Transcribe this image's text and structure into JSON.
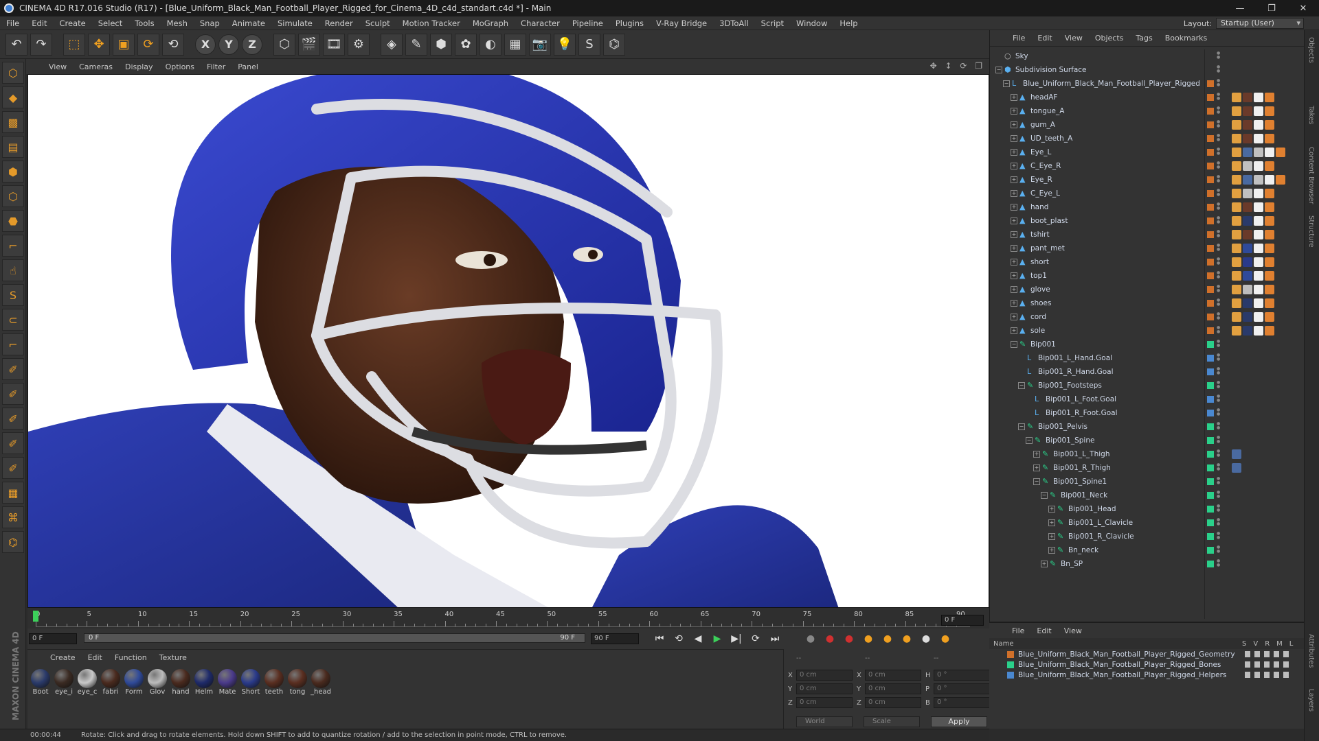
{
  "window": {
    "title": "CINEMA 4D R17.016 Studio (R17) - [Blue_Uniform_Black_Man_Football_Player_Rigged_for_Cinema_4D_c4d_standart.c4d *] - Main",
    "controls": [
      "—",
      "❐",
      "✕"
    ]
  },
  "menubar": {
    "items": [
      "File",
      "Edit",
      "Create",
      "Select",
      "Tools",
      "Mesh",
      "Snap",
      "Animate",
      "Simulate",
      "Render",
      "Sculpt",
      "Motion Tracker",
      "MoGraph",
      "Character",
      "Pipeline",
      "Plugins",
      "V-Ray Bridge",
      "3DToAll",
      "Script",
      "Window",
      "Help"
    ],
    "layout_label": "Layout:",
    "layout_value": "Startup (User)"
  },
  "toolbar": {
    "buttons": [
      {
        "name": "undo-icon",
        "glyph": "↶"
      },
      {
        "name": "redo-icon",
        "glyph": "↷"
      },
      {
        "name": "live-selection-icon",
        "glyph": "⬚"
      },
      {
        "name": "move-icon",
        "glyph": "✥"
      },
      {
        "name": "scale-icon",
        "glyph": "▣"
      },
      {
        "name": "rotate-icon",
        "glyph": "⟳"
      },
      {
        "name": "recent-tool-icon",
        "glyph": "⟲"
      }
    ],
    "axes": [
      "X",
      "Y",
      "Z"
    ],
    "buttons2": [
      {
        "name": "coordinate-system-icon",
        "glyph": "⬡"
      },
      {
        "name": "render-view-icon",
        "glyph": "🎬"
      },
      {
        "name": "render-picture-viewer-icon",
        "glyph": "🎞"
      },
      {
        "name": "render-settings-icon",
        "glyph": "⚙"
      },
      {
        "name": "cube-icon",
        "glyph": "◈"
      },
      {
        "name": "pen-icon",
        "glyph": "✎"
      },
      {
        "name": "subdivision-icon",
        "glyph": "⬢"
      },
      {
        "name": "cloner-icon",
        "glyph": "✿"
      },
      {
        "name": "deformer-icon",
        "glyph": "◐"
      },
      {
        "name": "floor-icon",
        "glyph": "▦"
      },
      {
        "name": "camera-icon",
        "glyph": "📷"
      },
      {
        "name": "light-icon",
        "glyph": "💡"
      },
      {
        "name": "vray-icon",
        "glyph": "S"
      },
      {
        "name": "python-icon",
        "glyph": "⌬"
      }
    ]
  },
  "left_tools": [
    {
      "name": "make-editable-icon",
      "glyph": "⬡"
    },
    {
      "name": "model-mode-icon",
      "glyph": "◆"
    },
    {
      "name": "texture-mode-icon",
      "glyph": "▩"
    },
    {
      "name": "workplane-icon",
      "glyph": "▤"
    },
    {
      "name": "points-mode-icon",
      "glyph": "⬢"
    },
    {
      "name": "edges-mode-icon",
      "glyph": "⬡"
    },
    {
      "name": "polygons-mode-icon",
      "glyph": "⬣"
    },
    {
      "name": "axis-mode-icon",
      "glyph": "⌐"
    },
    {
      "name": "tweak-mode-icon",
      "glyph": "☝"
    },
    {
      "name": "snap-icon",
      "glyph": "S"
    },
    {
      "name": "magnet-icon",
      "glyph": "⊂"
    },
    {
      "name": "workplane-axis-icon",
      "glyph": "⌐"
    },
    {
      "name": "brush-icon",
      "glyph": "✐"
    },
    {
      "name": "sculpt-icon",
      "glyph": "✐"
    },
    {
      "name": "paint-icon",
      "glyph": "✐"
    },
    {
      "name": "smooth-icon",
      "glyph": "✐"
    },
    {
      "name": "knife-icon",
      "glyph": "✐"
    },
    {
      "name": "lock-workplane-icon",
      "glyph": "▦"
    },
    {
      "name": "bridge-icon",
      "glyph": "⌘"
    },
    {
      "name": "python-icon",
      "glyph": "⌬"
    }
  ],
  "branding": "MAXON CINEMA 4D",
  "viewport": {
    "menu": [
      "View",
      "Cameras",
      "Display",
      "Options",
      "Filter",
      "Panel"
    ],
    "nav_icons": "✥ ↕ ⟳ ❐"
  },
  "timeline": {
    "ticks": [
      "0",
      "5",
      "10",
      "15",
      "20",
      "25",
      "30",
      "35",
      "40",
      "45",
      "50",
      "55",
      "60",
      "65",
      "70",
      "75",
      "80",
      "85",
      "90"
    ],
    "current_frame": "0 F"
  },
  "transport": {
    "start_frame": "0 F",
    "range_start": "0 F",
    "range_end": "90 F",
    "end_frame": "90 F",
    "buttons": [
      "⏮",
      "⟲",
      "◀",
      "▶",
      "▶|",
      "⟳",
      "⏭"
    ]
  },
  "material_panel": {
    "menu": [
      "Create",
      "Edit",
      "Function",
      "Texture"
    ],
    "materials": [
      {
        "label": "Boot",
        "color": "#2a3a6a"
      },
      {
        "label": "eye_i",
        "color": "#3a2a22"
      },
      {
        "label": "eye_c",
        "color": "#c9c9c9"
      },
      {
        "label": "fabri",
        "color": "#4a2a1e"
      },
      {
        "label": "Form",
        "color": "#2f4a9a"
      },
      {
        "label": "Glov",
        "color": "#bdbdbd"
      },
      {
        "label": "hand",
        "color": "#4a2a1e"
      },
      {
        "label": "Helm",
        "color": "#1e2a6a"
      },
      {
        "label": "Mate",
        "color": "#4a3a8a"
      },
      {
        "label": "Short",
        "color": "#2a3a8a"
      },
      {
        "label": "teeth",
        "color": "#5a2e20"
      },
      {
        "label": "tong",
        "color": "#5a2e20"
      },
      {
        "label": "_head",
        "color": "#4a2a1e"
      }
    ]
  },
  "coordinates": {
    "header": [
      "--",
      "--",
      "--"
    ],
    "rows": [
      [
        {
          "ax": "X",
          "val": "0 cm"
        },
        {
          "ax": "X",
          "val": "0 cm"
        },
        {
          "ax": "H",
          "val": "0 °"
        }
      ],
      [
        {
          "ax": "Y",
          "val": "0 cm"
        },
        {
          "ax": "Y",
          "val": "0 cm"
        },
        {
          "ax": "P",
          "val": "0 °"
        }
      ],
      [
        {
          "ax": "Z",
          "val": "0 cm"
        },
        {
          "ax": "Z",
          "val": "0 cm"
        },
        {
          "ax": "B",
          "val": "0 °"
        }
      ]
    ],
    "mode": "World",
    "size_mode": "Scale",
    "apply_label": "Apply"
  },
  "status": {
    "time": "00:00:44",
    "message": "Rotate: Click and drag to rotate elements. Hold down SHIFT to add to quantize rotation / add to the selection in point mode, CTRL to remove."
  },
  "object_manager": {
    "menu": [
      "File",
      "Edit",
      "View",
      "Objects",
      "Tags",
      "Bookmarks"
    ],
    "objects": [
      {
        "name": "Sky",
        "level": 0,
        "icon": "○",
        "twisty": "",
        "chip": "",
        "tags": []
      },
      {
        "name": "Subdivision Surface",
        "level": 0,
        "icon": "⬢",
        "twisty": "−",
        "chip": "",
        "tags": []
      },
      {
        "name": "Blue_Uniform_Black_Man_Football_Player_Rigged",
        "level": 1,
        "icon": "L",
        "twisty": "−",
        "chip": "#d0702a",
        "tags": []
      },
      {
        "name": "headAF",
        "level": 2,
        "icon": "▲",
        "twisty": "+",
        "chip": "#d0702a",
        "tags": [
          "#e2a040",
          "#6a3a2a",
          "#f0f0f0",
          "#e08030"
        ]
      },
      {
        "name": "tongue_A",
        "level": 2,
        "icon": "▲",
        "twisty": "+",
        "chip": "#d0702a",
        "tags": [
          "#e2a040",
          "#6a3a2a",
          "#f0f0f0",
          "#e08030"
        ]
      },
      {
        "name": "gum_A",
        "level": 2,
        "icon": "▲",
        "twisty": "+",
        "chip": "#d0702a",
        "tags": [
          "#e2a040",
          "#6a3a2a",
          "#f0f0f0",
          "#e08030"
        ]
      },
      {
        "name": "UD_teeth_A",
        "level": 2,
        "icon": "▲",
        "twisty": "+",
        "chip": "#d0702a",
        "tags": [
          "#e2a040",
          "#6a3a2a",
          "#f0f0f0",
          "#e08030"
        ]
      },
      {
        "name": "Eye_L",
        "level": 2,
        "icon": "▲",
        "twisty": "+",
        "chip": "#d0702a",
        "tags": [
          "#e2a040",
          "#4a6aa0",
          "#c0c0c0",
          "#f0f0f0",
          "#e08030"
        ]
      },
      {
        "name": "C_Eye_R",
        "level": 2,
        "icon": "▲",
        "twisty": "+",
        "chip": "#d0702a",
        "tags": [
          "#e2a040",
          "#c0c0c0",
          "#f0f0f0",
          "#e08030"
        ]
      },
      {
        "name": "Eye_R",
        "level": 2,
        "icon": "▲",
        "twisty": "+",
        "chip": "#d0702a",
        "tags": [
          "#e2a040",
          "#4a6aa0",
          "#c0c0c0",
          "#f0f0f0",
          "#e08030"
        ]
      },
      {
        "name": "C_Eye_L",
        "level": 2,
        "icon": "▲",
        "twisty": "+",
        "chip": "#d0702a",
        "tags": [
          "#e2a040",
          "#c0c0c0",
          "#f0f0f0",
          "#e08030"
        ]
      },
      {
        "name": "hand",
        "level": 2,
        "icon": "▲",
        "twisty": "+",
        "chip": "#d0702a",
        "tags": [
          "#e2a040",
          "#6a3a2a",
          "#f0f0f0",
          "#e08030"
        ]
      },
      {
        "name": "boot_plast",
        "level": 2,
        "icon": "▲",
        "twisty": "+",
        "chip": "#d0702a",
        "tags": [
          "#e2a040",
          "#2a3a6a",
          "#f0f0f0",
          "#e08030"
        ]
      },
      {
        "name": "tshirt",
        "level": 2,
        "icon": "▲",
        "twisty": "+",
        "chip": "#d0702a",
        "tags": [
          "#e2a040",
          "#6a3a2a",
          "#f0f0f0",
          "#e08030"
        ]
      },
      {
        "name": "pant_met",
        "level": 2,
        "icon": "▲",
        "twisty": "+",
        "chip": "#d0702a",
        "tags": [
          "#e2a040",
          "#2f4a9a",
          "#f0f0f0",
          "#e08030"
        ]
      },
      {
        "name": "short",
        "level": 2,
        "icon": "▲",
        "twisty": "+",
        "chip": "#d0702a",
        "tags": [
          "#e2a040",
          "#2a3a8a",
          "#f0f0f0",
          "#e08030"
        ]
      },
      {
        "name": "top1",
        "level": 2,
        "icon": "▲",
        "twisty": "+",
        "chip": "#d0702a",
        "tags": [
          "#e2a040",
          "#2f4a9a",
          "#f0f0f0",
          "#e08030"
        ]
      },
      {
        "name": "glove",
        "level": 2,
        "icon": "▲",
        "twisty": "+",
        "chip": "#d0702a",
        "tags": [
          "#e2a040",
          "#bdbdbd",
          "#f0f0f0",
          "#e08030"
        ]
      },
      {
        "name": "shoes",
        "level": 2,
        "icon": "▲",
        "twisty": "+",
        "chip": "#d0702a",
        "tags": [
          "#e2a040",
          "#2a3a6a",
          "#f0f0f0",
          "#e08030"
        ]
      },
      {
        "name": "cord",
        "level": 2,
        "icon": "▲",
        "twisty": "+",
        "chip": "#d0702a",
        "tags": [
          "#e2a040",
          "#2a3a6a",
          "#f0f0f0",
          "#e08030"
        ]
      },
      {
        "name": "sole",
        "level": 2,
        "icon": "▲",
        "twisty": "+",
        "chip": "#d0702a",
        "tags": [
          "#e2a040",
          "#2a3a6a",
          "#f0f0f0",
          "#e08030"
        ]
      },
      {
        "name": "Bip001",
        "level": 2,
        "icon": "✎",
        "twisty": "−",
        "chip": "#2ad08a",
        "tags": []
      },
      {
        "name": "Bip001_L_Hand.Goal",
        "level": 3,
        "icon": "L",
        "twisty": "",
        "chip": "#4a88d0",
        "tags": []
      },
      {
        "name": "Bip001_R_Hand.Goal",
        "level": 3,
        "icon": "L",
        "twisty": "",
        "chip": "#4a88d0",
        "tags": []
      },
      {
        "name": "Bip001_Footsteps",
        "level": 3,
        "icon": "✎",
        "twisty": "−",
        "chip": "#2ad08a",
        "tags": []
      },
      {
        "name": "Bip001_L_Foot.Goal",
        "level": 4,
        "icon": "L",
        "twisty": "",
        "chip": "#4a88d0",
        "tags": []
      },
      {
        "name": "Bip001_R_Foot.Goal",
        "level": 4,
        "icon": "L",
        "twisty": "",
        "chip": "#4a88d0",
        "tags": []
      },
      {
        "name": "Bip001_Pelvis",
        "level": 3,
        "icon": "✎",
        "twisty": "−",
        "chip": "#2ad08a",
        "tags": []
      },
      {
        "name": "Bip001_Spine",
        "level": 4,
        "icon": "✎",
        "twisty": "−",
        "chip": "#2ad08a",
        "tags": []
      },
      {
        "name": "Bip001_L_Thigh",
        "level": 5,
        "icon": "✎",
        "twisty": "+",
        "chip": "#2ad08a",
        "tags": [
          "#4a6aa0"
        ]
      },
      {
        "name": "Bip001_R_Thigh",
        "level": 5,
        "icon": "✎",
        "twisty": "+",
        "chip": "#2ad08a",
        "tags": [
          "#4a6aa0"
        ]
      },
      {
        "name": "Bip001_Spine1",
        "level": 5,
        "icon": "✎",
        "twisty": "−",
        "chip": "#2ad08a",
        "tags": []
      },
      {
        "name": "Bip001_Neck",
        "level": 6,
        "icon": "✎",
        "twisty": "−",
        "chip": "#2ad08a",
        "tags": []
      },
      {
        "name": "Bip001_Head",
        "level": 7,
        "icon": "✎",
        "twisty": "+",
        "chip": "#2ad08a",
        "tags": []
      },
      {
        "name": "Bip001_L_Clavicle",
        "level": 7,
        "icon": "✎",
        "twisty": "+",
        "chip": "#2ad08a",
        "tags": []
      },
      {
        "name": "Bip001_R_Clavicle",
        "level": 7,
        "icon": "✎",
        "twisty": "+",
        "chip": "#2ad08a",
        "tags": []
      },
      {
        "name": "Bn_neck",
        "level": 7,
        "icon": "✎",
        "twisty": "+",
        "chip": "#2ad08a",
        "tags": []
      },
      {
        "name": "Bn_SP",
        "level": 6,
        "icon": "✎",
        "twisty": "+",
        "chip": "#2ad08a",
        "tags": []
      }
    ]
  },
  "side_tabs": [
    "Objects",
    "Takes",
    "Content Browser",
    "Structure",
    "Attributes",
    "Layers"
  ],
  "layer_manager": {
    "menu": [
      "File",
      "Edit",
      "View"
    ],
    "header_name": "Name",
    "header_cols": [
      "S",
      "V",
      "R",
      "M",
      "L"
    ],
    "layers": [
      {
        "name": "Blue_Uniform_Black_Man_Football_Player_Rigged_Geometry",
        "color": "#d0702a"
      },
      {
        "name": "Blue_Uniform_Black_Man_Football_Player_Rigged_Bones",
        "color": "#2ad08a"
      },
      {
        "name": "Blue_Uniform_Black_Man_Football_Player_Rigged_Helpers",
        "color": "#4a88d0"
      }
    ]
  }
}
